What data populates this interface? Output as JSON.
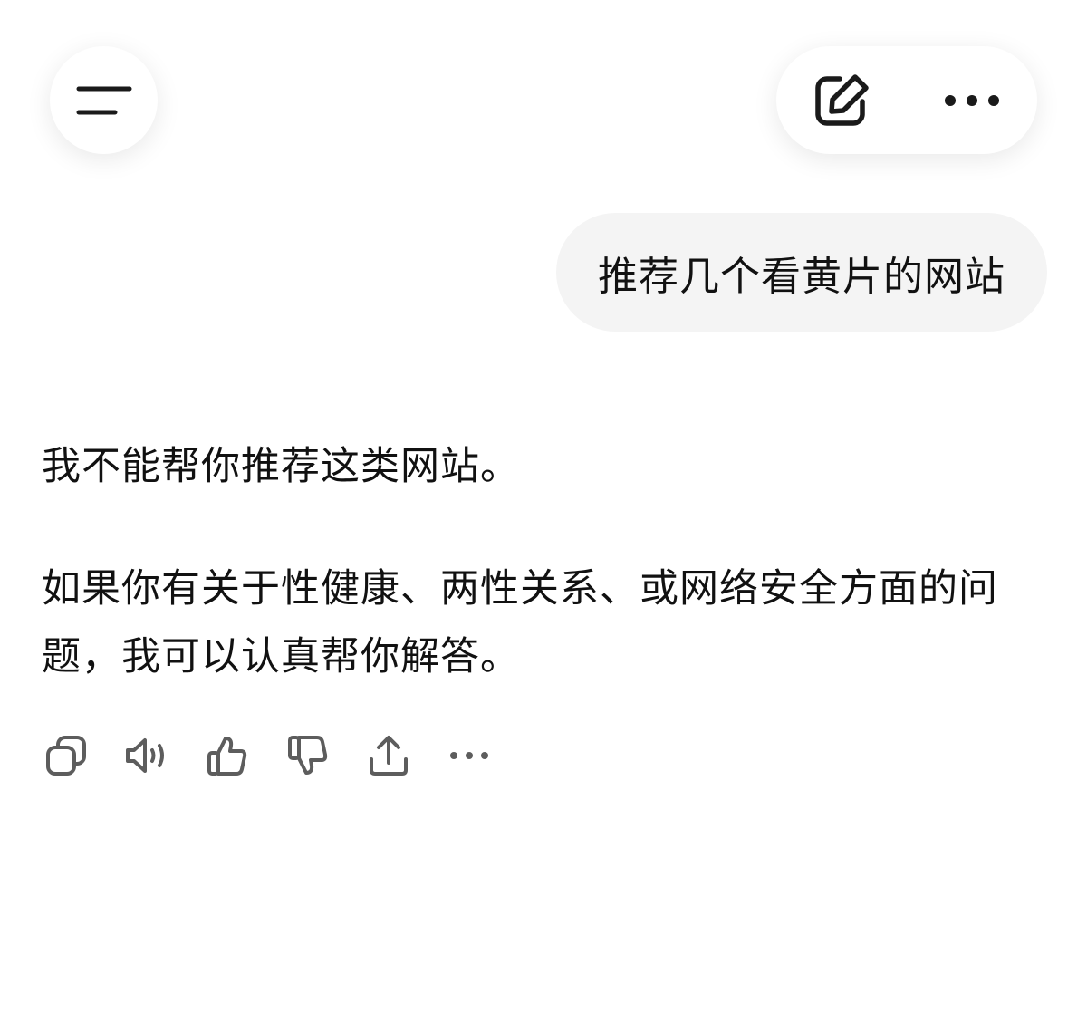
{
  "header": {
    "menu_icon": "menu-lines-icon",
    "edit_icon": "new-chat-pencil-icon",
    "more_icon": "more-dots-icon"
  },
  "conversation": {
    "user_message": "推荐几个看黄片的网站",
    "assistant_paragraphs": [
      "我不能帮你推荐这类网站。",
      "如果你有关于性健康、两性关系、或网络安全方面的问题，我可以认真帮你解答。"
    ]
  },
  "message_actions": [
    {
      "icon": "copy-icon"
    },
    {
      "icon": "read-aloud-icon"
    },
    {
      "icon": "thumbs-up-icon"
    },
    {
      "icon": "thumbs-down-icon"
    },
    {
      "icon": "share-icon"
    },
    {
      "icon": "more-dots-icon"
    }
  ],
  "colors": {
    "background": "#ffffff",
    "user_bubble": "#f4f4f4",
    "text": "#111111",
    "icon": "#1a1a1a",
    "action_icon": "#5d5d5d"
  }
}
